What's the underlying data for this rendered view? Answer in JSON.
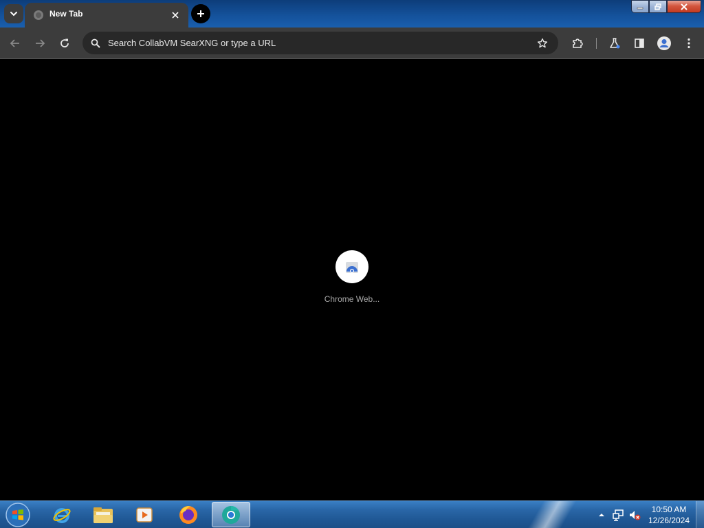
{
  "browser": {
    "tabs": [
      {
        "title": "New Tab",
        "active": true,
        "favicon": "globe-icon"
      }
    ],
    "omnibox": {
      "placeholder": "Search CollabVM SearXNG or type a URL"
    },
    "toolbar_icons": [
      "back-icon",
      "forward-icon",
      "reload-icon",
      "star-icon",
      "extensions-icon",
      "labs-icon",
      "side-panel-icon",
      "profile-icon",
      "menu-icon"
    ],
    "accent_color": "#3c3c3c"
  },
  "new_tab_page": {
    "shortcuts": [
      {
        "label": "Chrome Web...",
        "icon": "chrome-web-store-icon"
      }
    ]
  },
  "taskbar": {
    "pinned_apps": [
      "internet-explorer-icon",
      "file-explorer-icon",
      "media-player-icon",
      "firefox-icon",
      "chrome-icon"
    ],
    "active_app": "chrome-icon",
    "clock": {
      "time": "10:50 AM",
      "date": "12/26/2024"
    },
    "tray_icons": [
      "show-hidden-icons-icon",
      "network-icon",
      "volume-muted-icon"
    ]
  }
}
